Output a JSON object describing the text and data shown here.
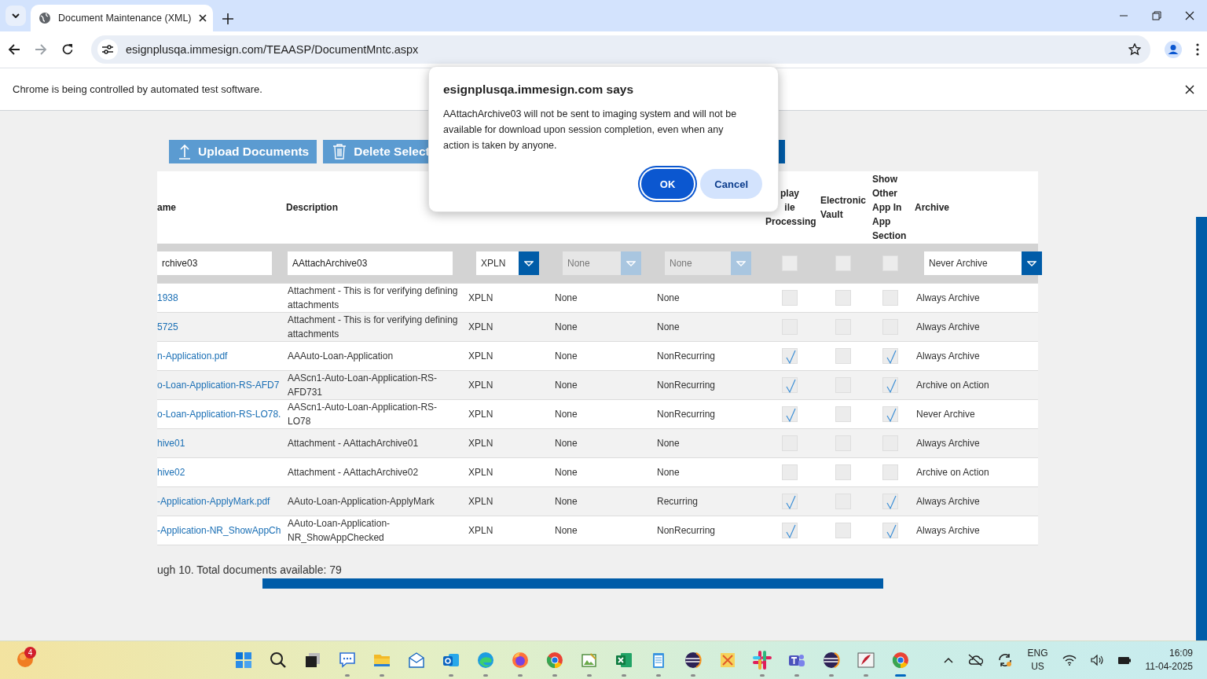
{
  "browser": {
    "tab_title": "Document Maintenance (XML)",
    "url": "esignplusqa.immesign.com/TEAASP/DocumentMntc.aspx",
    "infobar": "Chrome is being controlled by automated test software."
  },
  "toolbar": {
    "buttons": [
      {
        "label": "Upload Documents",
        "kind": "upload"
      },
      {
        "label": "Delete Select",
        "kind": "delete"
      }
    ]
  },
  "table": {
    "columns": {
      "name": "ame",
      "description": "Description",
      "display_while_processing": "play\nile\nProcessing",
      "electronic_vault": "Electronic Vault",
      "show_other_app": "Show Other App In App Section",
      "archive": "Archive"
    },
    "filter": {
      "name": "rchive03",
      "description": "AAttachArchive03",
      "column_3": {
        "value": "XPLN",
        "disabled": false
      },
      "column_4": {
        "value": "None",
        "disabled": true
      },
      "column_5": {
        "value": "None",
        "disabled": true
      },
      "display_while_processing": false,
      "electronic_vault": false,
      "show_other_app": false,
      "archive": {
        "value": "Never Archive",
        "disabled": false
      }
    },
    "rows": [
      {
        "name": "1938",
        "description": "Attachment - This is for verifying defining attachments",
        "column_3": "XPLN",
        "column_4": "None",
        "column_5": "None",
        "display_while_processing": false,
        "electronic_vault": false,
        "show_other_app": false,
        "archive": "Always Archive"
      },
      {
        "name": "5725",
        "description": "Attachment - This is for verifying defining attachments",
        "column_3": "XPLN",
        "column_4": "None",
        "column_5": "None",
        "display_while_processing": false,
        "electronic_vault": false,
        "show_other_app": false,
        "archive": "Always Archive"
      },
      {
        "name": "n-Application.pdf",
        "description": "AAAuto-Loan-Application",
        "column_3": "XPLN",
        "column_4": "None",
        "column_5": "NonRecurring",
        "display_while_processing": true,
        "electronic_vault": false,
        "show_other_app": true,
        "archive": "Always Archive"
      },
      {
        "name": "o-Loan-Application-RS-AFD7",
        "description": "AAScn1-Auto-Loan-Application-RS-AFD731",
        "column_3": "XPLN",
        "column_4": "None",
        "column_5": "NonRecurring",
        "display_while_processing": true,
        "electronic_vault": false,
        "show_other_app": true,
        "archive": "Archive on Action"
      },
      {
        "name": "o-Loan-Application-RS-LO78.",
        "description": "AAScn1-Auto-Loan-Application-RS-LO78",
        "column_3": "XPLN",
        "column_4": "None",
        "column_5": "NonRecurring",
        "display_while_processing": true,
        "electronic_vault": false,
        "show_other_app": true,
        "archive": "Never Archive"
      },
      {
        "name": "hive01",
        "description": "Attachment - AAttachArchive01",
        "column_3": "XPLN",
        "column_4": "None",
        "column_5": "None",
        "display_while_processing": false,
        "electronic_vault": false,
        "show_other_app": false,
        "archive": "Always Archive"
      },
      {
        "name": "hive02",
        "description": "Attachment - AAttachArchive02",
        "column_3": "XPLN",
        "column_4": "None",
        "column_5": "None",
        "display_while_processing": false,
        "electronic_vault": false,
        "show_other_app": false,
        "archive": "Archive on Action"
      },
      {
        "name": "-Application-ApplyMark.pdf",
        "description": "AAuto-Loan-Application-ApplyMark",
        "column_3": "XPLN",
        "column_4": "None",
        "column_5": "Recurring",
        "display_while_processing": true,
        "electronic_vault": false,
        "show_other_app": true,
        "archive": "Always Archive"
      },
      {
        "name": "-Application-NR_ShowAppCh",
        "description": "AAuto-Loan-Application-NR_ShowAppChecked",
        "column_3": "XPLN",
        "column_4": "None",
        "column_5": "NonRecurring",
        "display_while_processing": true,
        "electronic_vault": false,
        "show_other_app": true,
        "archive": "Always Archive"
      }
    ],
    "footer": "ugh 10. Total documents available: 79"
  },
  "dialog": {
    "title": "esignplusqa.immesign.com says",
    "message": "AAttachArchive03 will not be sent to imaging system and will not be available for download upon session completion, even when any action is taken by anyone.",
    "buttons": [
      {
        "label": "OK",
        "selected": true
      },
      {
        "label": "Cancel",
        "selected": false
      }
    ]
  },
  "taskbar": {
    "badge": "4",
    "apps": [
      {
        "kind": "start",
        "open": false,
        "selected": false
      },
      {
        "kind": "search",
        "open": false,
        "selected": false
      },
      {
        "kind": "taskview",
        "open": false,
        "selected": false
      },
      {
        "kind": "chat",
        "open": true,
        "selected": false
      },
      {
        "kind": "folder",
        "open": true,
        "selected": false
      },
      {
        "kind": "mail",
        "open": false,
        "selected": false
      },
      {
        "kind": "outlook",
        "open": true,
        "selected": false
      },
      {
        "kind": "edge",
        "open": true,
        "selected": false
      },
      {
        "kind": "firefox",
        "open": true,
        "selected": false
      },
      {
        "kind": "chrome",
        "open": true,
        "selected": false
      },
      {
        "kind": "paint",
        "open": true,
        "selected": false
      },
      {
        "kind": "excel",
        "open": true,
        "selected": false
      },
      {
        "kind": "notepad",
        "open": true,
        "selected": false
      },
      {
        "kind": "eclipse",
        "open": true,
        "selected": false
      },
      {
        "kind": "tool",
        "open": false,
        "selected": false
      },
      {
        "kind": "slack",
        "open": true,
        "selected": false
      },
      {
        "kind": "teams",
        "open": true,
        "selected": false
      },
      {
        "kind": "eclipse",
        "open": true,
        "selected": false
      },
      {
        "kind": "jmeter",
        "open": true,
        "selected": false
      },
      {
        "kind": "chrome",
        "open": true,
        "selected": true
      }
    ],
    "language": "ENG",
    "region": "US",
    "time": "16:09",
    "date": "11-04-2025"
  }
}
